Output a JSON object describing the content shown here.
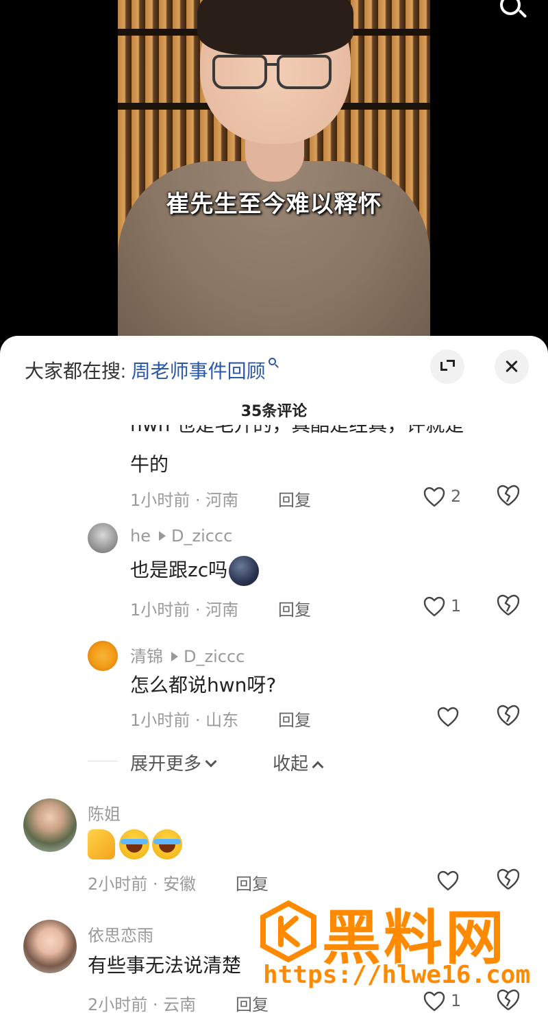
{
  "video": {
    "subtitle": "崔先生至今难以释怀",
    "search_icon": "search-icon"
  },
  "sheet": {
    "hot_search_label": "大家都在搜:",
    "hot_search_term": "周老师事件回顾",
    "comment_count": "35条评论",
    "icons": {
      "expand": "expand-icon",
      "close": "close-icon"
    }
  },
  "comments": {
    "cutoff_partial": "hwn 也是毛开的，真酷是经真，评就是",
    "cutoff_text": "牛的",
    "cutoff_meta": "1小时前 · 河南",
    "cutoff_reply": "回复",
    "cutoff_likes": "2",
    "reply1": {
      "user": "he",
      "reply_to": "D_ziccc",
      "text": "也是跟zc吗",
      "meta": "1小时前 · 河南",
      "reply": "回复",
      "likes": "1"
    },
    "reply2": {
      "user": "清锦",
      "reply_to": "D_ziccc",
      "text": "怎么都说hwn呀?",
      "meta": "1小时前 · 山东",
      "reply": "回复"
    },
    "expand_more": "展开更多",
    "collapse": "收起",
    "c1": {
      "user": "陈姐",
      "meta": "2小时前 · 安徽",
      "reply": "回复"
    },
    "c2": {
      "user": "依思恋雨",
      "text": "有些事无法说清楚",
      "meta": "2小时前 · 云南",
      "reply": "回复",
      "likes": "1"
    }
  },
  "watermark": {
    "title": "黑料网",
    "url": "https://hlwe16.com"
  },
  "colors": {
    "accent_link": "#2a58a8",
    "watermark": "#ff8a00"
  }
}
